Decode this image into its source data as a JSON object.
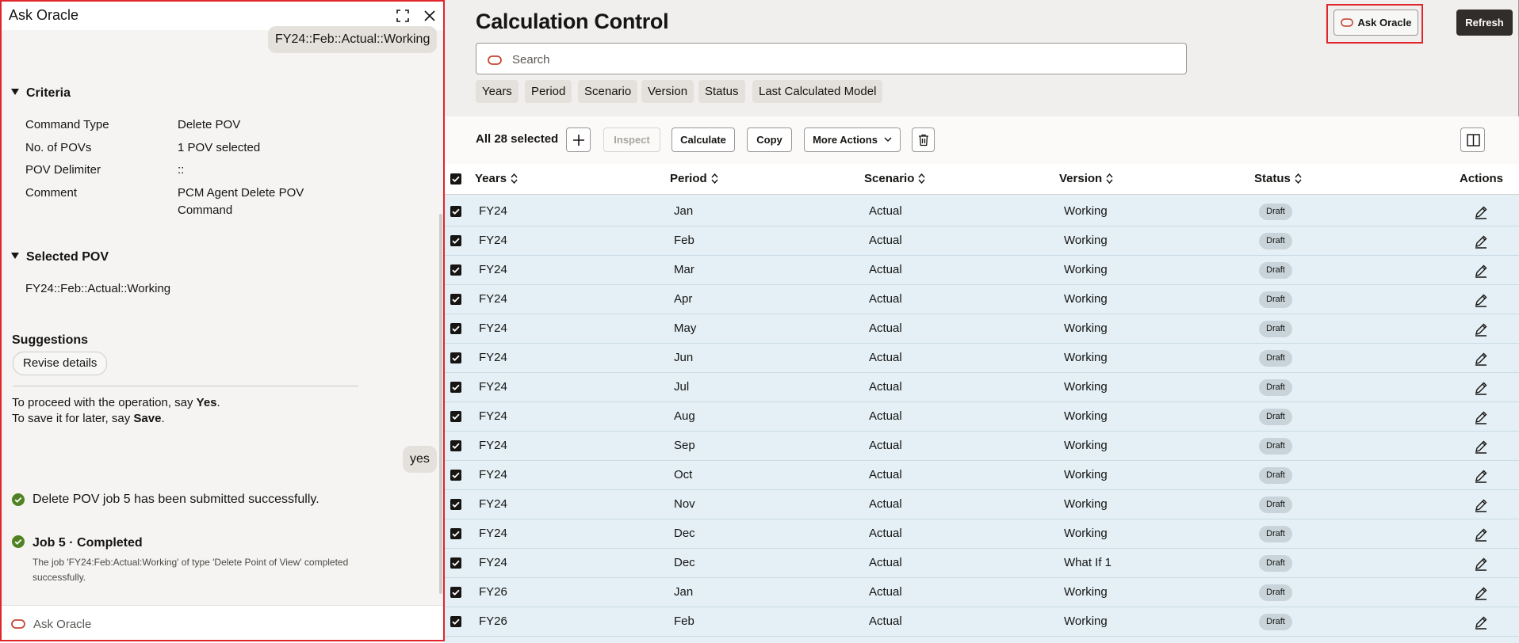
{
  "panel": {
    "title": "Ask Oracle",
    "user_message_top": "FY24::Feb::Actual::Working",
    "criteria_heading": "Criteria",
    "criteria": [
      {
        "label": "Command Type",
        "value": "Delete POV"
      },
      {
        "label": "No. of POVs",
        "value": "1 POV selected"
      },
      {
        "label": "POV Delimiter",
        "value": "::"
      },
      {
        "label": "Comment",
        "value": "PCM Agent Delete POV Command"
      }
    ],
    "selected_pov_heading": "Selected POV",
    "selected_pov": "FY24::Feb::Actual::Working",
    "suggestions_heading": "Suggestions",
    "suggestion_chip": "Revise details",
    "proceed_prefix": "To proceed with the operation, say ",
    "proceed_keyword": "Yes",
    "proceed_suffix": ".",
    "save_prefix": "To save it for later, say ",
    "save_keyword": "Save",
    "save_suffix": ".",
    "user_reply": "yes",
    "submit_message": "Delete POV job 5 has been submitted successfully.",
    "job_title": "Job 5 · Completed",
    "job_detail": "The job 'FY24:Feb:Actual:Working' of type 'Delete Point of View' completed successfully.",
    "input_placeholder": "Ask Oracle",
    "icons": {
      "expand": "expand-icon",
      "close": "close-icon",
      "success": "check-circle-icon",
      "oracle": "oracle-logo-icon"
    }
  },
  "main": {
    "title": "Calculation Control",
    "ask_oracle_label": "Ask Oracle",
    "refresh_label": "Refresh",
    "search_placeholder": "Search",
    "filters": [
      "Years",
      "Period",
      "Scenario",
      "Version",
      "Status",
      "Last Calculated Model"
    ],
    "selected_count": "All 28 selected",
    "toolbar": {
      "inspect": "Inspect",
      "calculate": "Calculate",
      "copy": "Copy",
      "more_actions": "More Actions"
    },
    "columns": [
      "Years",
      "Period",
      "Scenario",
      "Version",
      "Status",
      "Actions"
    ],
    "rows": [
      {
        "years": "FY24",
        "period": "Jan",
        "scenario": "Actual",
        "version": "Working",
        "status": "Draft"
      },
      {
        "years": "FY24",
        "period": "Feb",
        "scenario": "Actual",
        "version": "Working",
        "status": "Draft"
      },
      {
        "years": "FY24",
        "period": "Mar",
        "scenario": "Actual",
        "version": "Working",
        "status": "Draft"
      },
      {
        "years": "FY24",
        "period": "Apr",
        "scenario": "Actual",
        "version": "Working",
        "status": "Draft"
      },
      {
        "years": "FY24",
        "period": "May",
        "scenario": "Actual",
        "version": "Working",
        "status": "Draft"
      },
      {
        "years": "FY24",
        "period": "Jun",
        "scenario": "Actual",
        "version": "Working",
        "status": "Draft"
      },
      {
        "years": "FY24",
        "period": "Jul",
        "scenario": "Actual",
        "version": "Working",
        "status": "Draft"
      },
      {
        "years": "FY24",
        "period": "Aug",
        "scenario": "Actual",
        "version": "Working",
        "status": "Draft"
      },
      {
        "years": "FY24",
        "period": "Sep",
        "scenario": "Actual",
        "version": "Working",
        "status": "Draft"
      },
      {
        "years": "FY24",
        "period": "Oct",
        "scenario": "Actual",
        "version": "Working",
        "status": "Draft"
      },
      {
        "years": "FY24",
        "period": "Nov",
        "scenario": "Actual",
        "version": "Working",
        "status": "Draft"
      },
      {
        "years": "FY24",
        "period": "Dec",
        "scenario": "Actual",
        "version": "Working",
        "status": "Draft"
      },
      {
        "years": "FY24",
        "period": "Dec",
        "scenario": "Actual",
        "version": "What If 1",
        "status": "Draft"
      },
      {
        "years": "FY26",
        "period": "Jan",
        "scenario": "Actual",
        "version": "Working",
        "status": "Draft"
      },
      {
        "years": "FY26",
        "period": "Feb",
        "scenario": "Actual",
        "version": "Working",
        "status": "Draft"
      }
    ]
  },
  "colors": {
    "highlight_red": "#e0262b",
    "oracle_red": "#c74634",
    "success_green": "#508223",
    "selected_row": "#e4f0f6",
    "primary_button": "#312d2a"
  }
}
